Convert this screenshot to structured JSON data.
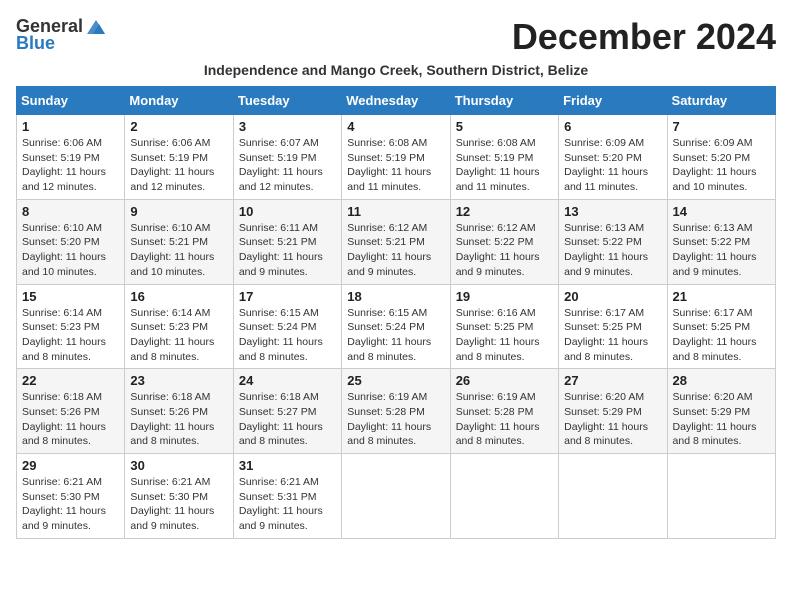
{
  "logo": {
    "general": "General",
    "blue": "Blue"
  },
  "title": "December 2024",
  "subtitle": "Independence and Mango Creek, Southern District, Belize",
  "days_of_week": [
    "Sunday",
    "Monday",
    "Tuesday",
    "Wednesday",
    "Thursday",
    "Friday",
    "Saturday"
  ],
  "weeks": [
    [
      {
        "day": "1",
        "sunrise": "6:06 AM",
        "sunset": "5:19 PM",
        "daylight": "11 hours and 12 minutes."
      },
      {
        "day": "2",
        "sunrise": "6:06 AM",
        "sunset": "5:19 PM",
        "daylight": "11 hours and 12 minutes."
      },
      {
        "day": "3",
        "sunrise": "6:07 AM",
        "sunset": "5:19 PM",
        "daylight": "11 hours and 12 minutes."
      },
      {
        "day": "4",
        "sunrise": "6:08 AM",
        "sunset": "5:19 PM",
        "daylight": "11 hours and 11 minutes."
      },
      {
        "day": "5",
        "sunrise": "6:08 AM",
        "sunset": "5:19 PM",
        "daylight": "11 hours and 11 minutes."
      },
      {
        "day": "6",
        "sunrise": "6:09 AM",
        "sunset": "5:20 PM",
        "daylight": "11 hours and 11 minutes."
      },
      {
        "day": "7",
        "sunrise": "6:09 AM",
        "sunset": "5:20 PM",
        "daylight": "11 hours and 10 minutes."
      }
    ],
    [
      {
        "day": "8",
        "sunrise": "6:10 AM",
        "sunset": "5:20 PM",
        "daylight": "11 hours and 10 minutes."
      },
      {
        "day": "9",
        "sunrise": "6:10 AM",
        "sunset": "5:21 PM",
        "daylight": "11 hours and 10 minutes."
      },
      {
        "day": "10",
        "sunrise": "6:11 AM",
        "sunset": "5:21 PM",
        "daylight": "11 hours and 9 minutes."
      },
      {
        "day": "11",
        "sunrise": "6:12 AM",
        "sunset": "5:21 PM",
        "daylight": "11 hours and 9 minutes."
      },
      {
        "day": "12",
        "sunrise": "6:12 AM",
        "sunset": "5:22 PM",
        "daylight": "11 hours and 9 minutes."
      },
      {
        "day": "13",
        "sunrise": "6:13 AM",
        "sunset": "5:22 PM",
        "daylight": "11 hours and 9 minutes."
      },
      {
        "day": "14",
        "sunrise": "6:13 AM",
        "sunset": "5:22 PM",
        "daylight": "11 hours and 9 minutes."
      }
    ],
    [
      {
        "day": "15",
        "sunrise": "6:14 AM",
        "sunset": "5:23 PM",
        "daylight": "11 hours and 8 minutes."
      },
      {
        "day": "16",
        "sunrise": "6:14 AM",
        "sunset": "5:23 PM",
        "daylight": "11 hours and 8 minutes."
      },
      {
        "day": "17",
        "sunrise": "6:15 AM",
        "sunset": "5:24 PM",
        "daylight": "11 hours and 8 minutes."
      },
      {
        "day": "18",
        "sunrise": "6:15 AM",
        "sunset": "5:24 PM",
        "daylight": "11 hours and 8 minutes."
      },
      {
        "day": "19",
        "sunrise": "6:16 AM",
        "sunset": "5:25 PM",
        "daylight": "11 hours and 8 minutes."
      },
      {
        "day": "20",
        "sunrise": "6:17 AM",
        "sunset": "5:25 PM",
        "daylight": "11 hours and 8 minutes."
      },
      {
        "day": "21",
        "sunrise": "6:17 AM",
        "sunset": "5:25 PM",
        "daylight": "11 hours and 8 minutes."
      }
    ],
    [
      {
        "day": "22",
        "sunrise": "6:18 AM",
        "sunset": "5:26 PM",
        "daylight": "11 hours and 8 minutes."
      },
      {
        "day": "23",
        "sunrise": "6:18 AM",
        "sunset": "5:26 PM",
        "daylight": "11 hours and 8 minutes."
      },
      {
        "day": "24",
        "sunrise": "6:18 AM",
        "sunset": "5:27 PM",
        "daylight": "11 hours and 8 minutes."
      },
      {
        "day": "25",
        "sunrise": "6:19 AM",
        "sunset": "5:28 PM",
        "daylight": "11 hours and 8 minutes."
      },
      {
        "day": "26",
        "sunrise": "6:19 AM",
        "sunset": "5:28 PM",
        "daylight": "11 hours and 8 minutes."
      },
      {
        "day": "27",
        "sunrise": "6:20 AM",
        "sunset": "5:29 PM",
        "daylight": "11 hours and 8 minutes."
      },
      {
        "day": "28",
        "sunrise": "6:20 AM",
        "sunset": "5:29 PM",
        "daylight": "11 hours and 8 minutes."
      }
    ],
    [
      {
        "day": "29",
        "sunrise": "6:21 AM",
        "sunset": "5:30 PM",
        "daylight": "11 hours and 9 minutes."
      },
      {
        "day": "30",
        "sunrise": "6:21 AM",
        "sunset": "5:30 PM",
        "daylight": "11 hours and 9 minutes."
      },
      {
        "day": "31",
        "sunrise": "6:21 AM",
        "sunset": "5:31 PM",
        "daylight": "11 hours and 9 minutes."
      },
      null,
      null,
      null,
      null
    ]
  ]
}
